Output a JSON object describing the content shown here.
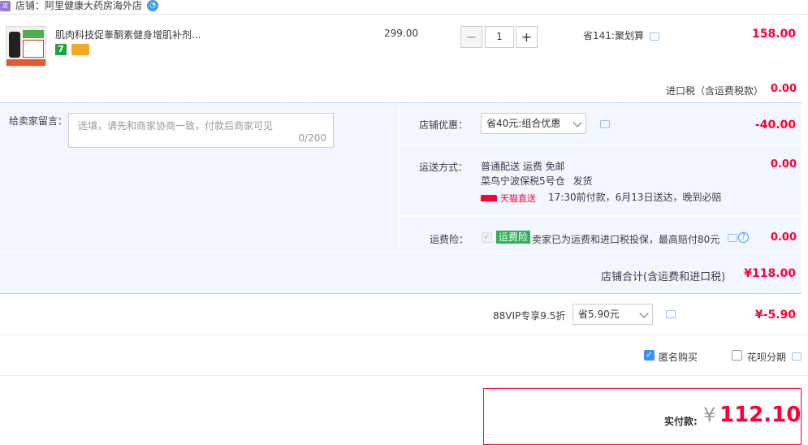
{
  "shop": {
    "label": "店铺：阿里健康大药房海外店",
    "icon_text": "店"
  },
  "item": {
    "title": "肌肉科技促睾酮素健身增肌补剂...",
    "unit_price": "299.00",
    "quantity": "1",
    "quantity_minus": "−",
    "quantity_plus": "+",
    "discount_note": "省141:聚划算",
    "subtotal": "158.00",
    "badge_7": "7"
  },
  "import_tax": {
    "label": "进口税（含运费税款）",
    "value": "0.00"
  },
  "message": {
    "label": "给卖家留言：",
    "placeholder": "选填，请先和商家协商一致，付款后商家可见",
    "counter": "0/200"
  },
  "shop_discount": {
    "label": "店铺优惠：",
    "selected": "省40元:组合优惠",
    "value": "-40.00"
  },
  "shipping": {
    "label": "运送方式：",
    "method": "普通配送 运费 免邮",
    "warehouse": "菜鸟宁波保税5号仓",
    "warehouse_suffix": "发货",
    "tmall_tag": "天猫直送",
    "delivery_note": "17:30前付款，6月13日送达，晚到必赔",
    "value": "0.00"
  },
  "shipping_insurance": {
    "label": "运费险：",
    "tag": "运费险",
    "text": "卖家已为运费和进口税投保，最高赔付80元",
    "value": "0.00"
  },
  "shop_total": {
    "label": "店铺合计(含运费和进口税)",
    "value": "¥118.00"
  },
  "vip": {
    "label": "88VIP专享9.5折",
    "selected": "省5.90元",
    "value": "¥-5.90"
  },
  "options": {
    "anonymous_label": "匿名购买",
    "anonymous_checked": true,
    "huabei_label": "花呗分期",
    "huabei_checked": false
  },
  "payment": {
    "label": "实付款:",
    "currency": "¥",
    "amount": "112.10"
  },
  "icons": [
    "shop-icon",
    "wangwang-icon",
    "chat-icon",
    "question-icon",
    "chevron-down-icon",
    "check-icon"
  ],
  "colors": {
    "price_red": "#ff0036",
    "panel_bg": "#f2f7ff",
    "panel_border": "#80b2ff",
    "check_blue": "#3e8df3",
    "insurance_green": "#2fae5a"
  }
}
